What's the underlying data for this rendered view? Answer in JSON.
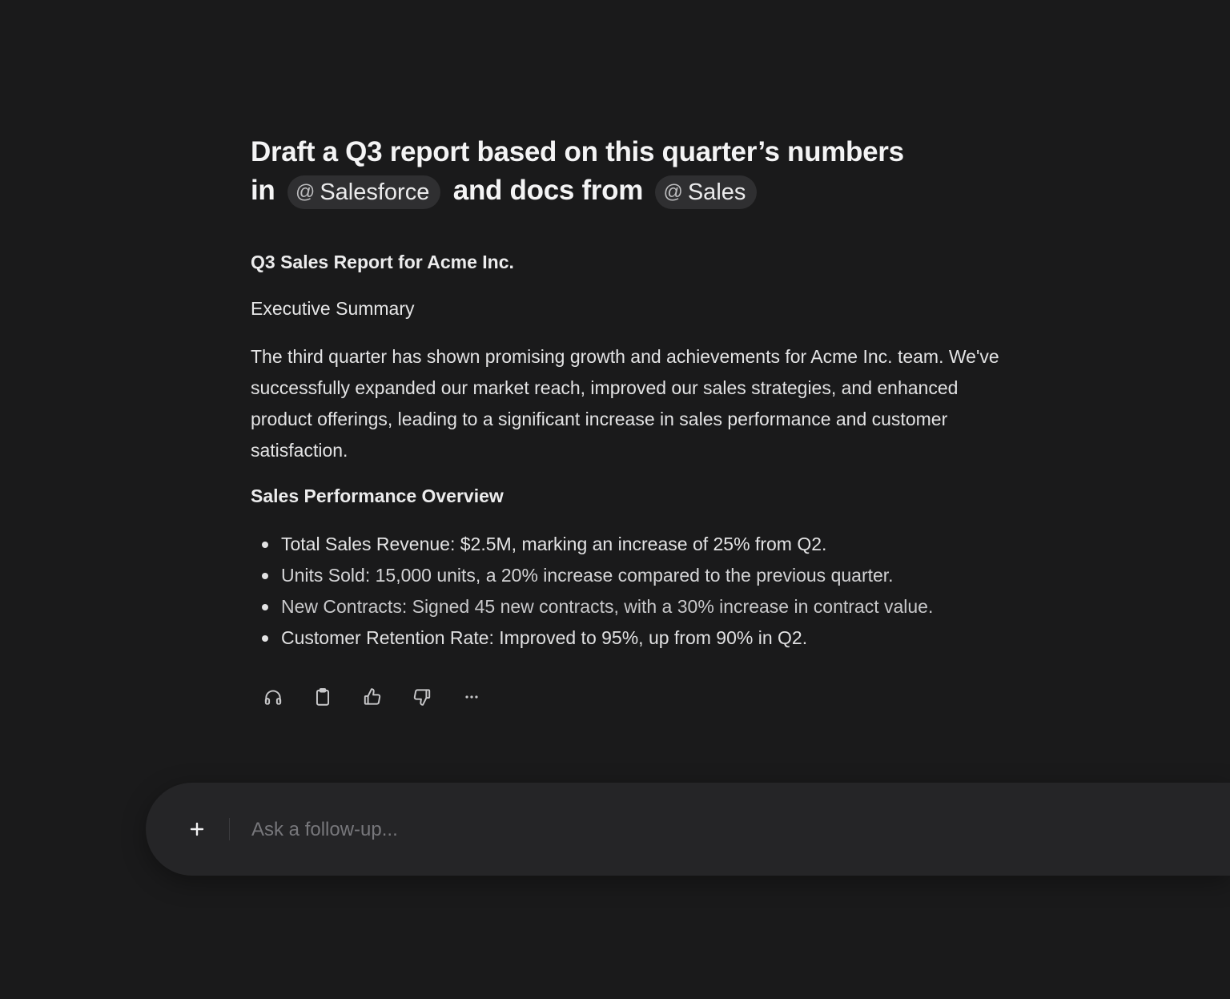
{
  "prompt": {
    "line1": "Draft a Q3 report based on this quarter’s numbers",
    "line2_prefix": "in",
    "mention1": {
      "symbol": "@",
      "label": "Salesforce"
    },
    "middle": "and docs from",
    "mention2": {
      "symbol": "@",
      "label": "Sales"
    }
  },
  "response": {
    "title": "Q3 Sales Report for Acme Inc.",
    "executive_summary_heading": "Executive Summary",
    "executive_summary": "The third quarter has shown promising growth and achievements for Acme Inc. team. We've successfully expanded our market reach, improved our sales strategies, and enhanced product offerings, leading to a significant increase in sales performance and customer satisfaction.",
    "performance_heading": "Sales Performance Overview",
    "bullets": [
      "Total Sales Revenue: $2.5M, marking an increase of 25% from Q2.",
      "Units Sold: 15,000 units, a 20% increase compared to the previous quarter.",
      "New Contracts: Signed 45 new contracts, with a 30% increase in contract value.",
      "Customer Retention Rate: Improved to 95%, up from 90% in Q2."
    ]
  },
  "actions": [
    {
      "icon": "headphones-icon"
    },
    {
      "icon": "clipboard-icon"
    },
    {
      "icon": "thumbs-up-icon"
    },
    {
      "icon": "thumbs-down-icon"
    },
    {
      "icon": "more-icon"
    }
  ],
  "composer": {
    "placeholder": "Ask a follow-up...",
    "value": ""
  },
  "colors": {
    "background": "#1a1a1b",
    "mention_bg": "#2f2f31",
    "composer_bg": "#252527",
    "text": "#e9e9ea",
    "placeholder": "#77777b"
  }
}
